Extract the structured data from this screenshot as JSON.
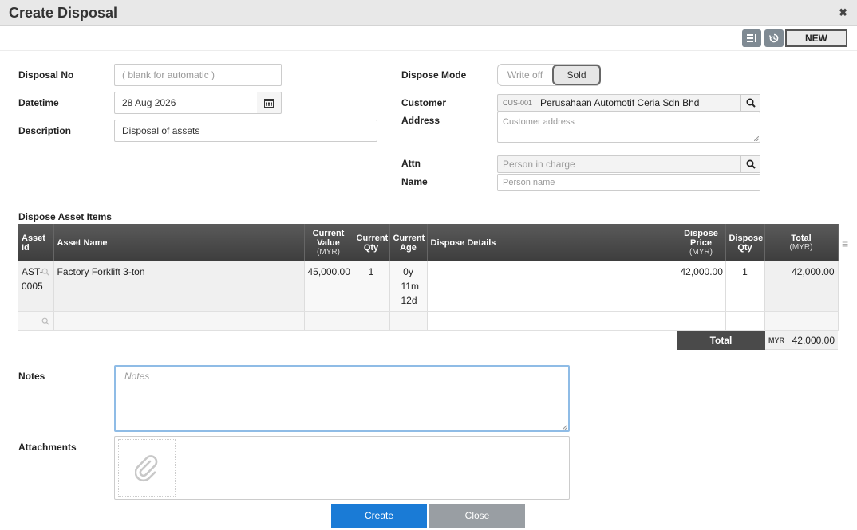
{
  "window": {
    "title": "Create Disposal"
  },
  "toolbar": {
    "new_label": "NEW"
  },
  "form": {
    "disposal_no": {
      "label": "Disposal No",
      "placeholder": "( blank for automatic )"
    },
    "datetime": {
      "label": "Datetime",
      "value": "28 Aug 2026"
    },
    "description": {
      "label": "Description",
      "value": "Disposal of assets"
    },
    "dispose_mode": {
      "label": "Dispose Mode",
      "options": [
        "Write off",
        "Sold"
      ],
      "selected": "Sold"
    },
    "customer": {
      "label": "Customer",
      "code": "CUS-001",
      "value": "Perusahaan Automotif Ceria Sdn Bhd"
    },
    "address": {
      "label": "Address",
      "placeholder": "Customer address"
    },
    "attn": {
      "label": "Attn",
      "placeholder": "Person in charge"
    },
    "name": {
      "label": "Name",
      "placeholder": "Person name"
    }
  },
  "items": {
    "section_label": "Dispose Asset Items",
    "columns": {
      "asset_id": "Asset Id",
      "asset_name": "Asset Name",
      "current_value": "Current Value",
      "current_value_unit": "(MYR)",
      "current_qty": "Current Qty",
      "current_age": "Current Age",
      "dispose_details": "Dispose Details",
      "dispose_price": "Dispose Price",
      "dispose_price_unit": "(MYR)",
      "dispose_qty": "Dispose Qty",
      "total": "Total",
      "total_unit": "(MYR)"
    },
    "rows": [
      {
        "asset_id": "AST-0005",
        "asset_name": "Factory Forklift 3-ton",
        "current_value": "45,000.00",
        "current_qty": "1",
        "current_age": "0y 11m 12d",
        "dispose_details": "",
        "dispose_price": "42,000.00",
        "dispose_qty": "1",
        "total": "42,000.00"
      }
    ],
    "total_label": "Total",
    "total_currency": "MYR",
    "total_value": "42,000.00"
  },
  "notes": {
    "label": "Notes",
    "placeholder": "Notes"
  },
  "attachments": {
    "label": "Attachments"
  },
  "actions": {
    "create_label": "Create",
    "close_label": "Close"
  }
}
